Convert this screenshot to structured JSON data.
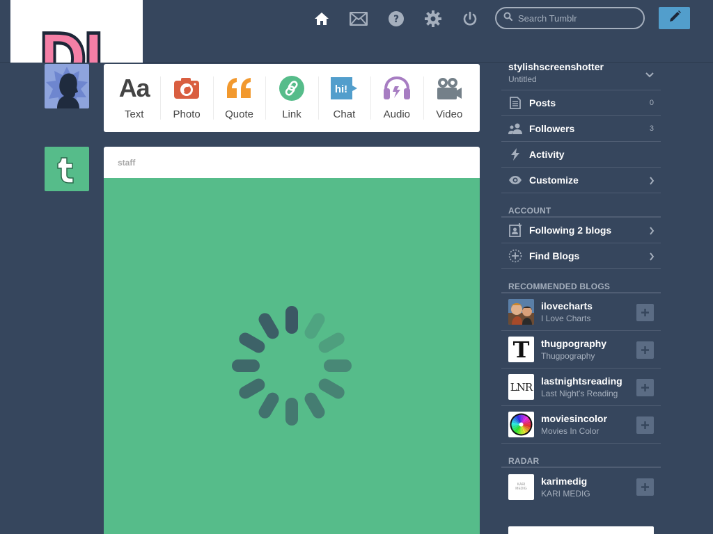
{
  "header": {
    "logo_text": "DL",
    "search": {
      "placeholder": "Search Tumblr",
      "value": ""
    },
    "nav_icons": [
      "home-icon",
      "mail-icon",
      "help-icon",
      "settings-icon",
      "power-icon"
    ],
    "compose_icon": "pencil-icon"
  },
  "post_types": [
    {
      "label": "Text",
      "icon": "text-icon",
      "color": "#444444"
    },
    {
      "label": "Photo",
      "icon": "camera-icon",
      "color": "#d95e40"
    },
    {
      "label": "Quote",
      "icon": "quote-icon",
      "color": "#f2992e"
    },
    {
      "label": "Link",
      "icon": "link-icon",
      "color": "#56bc8a"
    },
    {
      "label": "Chat",
      "icon": "chat-icon",
      "color": "#529ecc",
      "icon_text": "hi!"
    },
    {
      "label": "Audio",
      "icon": "headphones-icon",
      "color": "#a77dc2"
    },
    {
      "label": "Video",
      "icon": "video-camera-icon",
      "color": "#748089"
    }
  ],
  "staff_post": {
    "author": "staff",
    "state": "loading"
  },
  "sidebar": {
    "blog": {
      "name": "stylishscreenshotter",
      "title": "Untitled"
    },
    "items": [
      {
        "label": "Posts",
        "count": "0",
        "icon": "posts-icon"
      },
      {
        "label": "Followers",
        "count": "3",
        "icon": "followers-icon"
      },
      {
        "label": "Activity",
        "icon": "lightning-icon"
      },
      {
        "label": "Customize",
        "icon": "eye-icon"
      }
    ],
    "account_heading": "ACCOUNT",
    "account_items": [
      {
        "label": "Following 2 blogs",
        "icon": "following-icon"
      },
      {
        "label": "Find Blogs",
        "icon": "find-blogs-icon"
      }
    ],
    "recommended_heading": "RECOMMENDED BLOGS",
    "recommended": [
      {
        "name": "ilovecharts",
        "title": "I Love Charts"
      },
      {
        "name": "thugpography",
        "title": "Thugpography",
        "avatar_text": "T"
      },
      {
        "name": "lastnightsreading",
        "title": "Last Night's Reading",
        "avatar_text": "LNR"
      },
      {
        "name": "moviesincolor",
        "title": "Movies In Color"
      }
    ],
    "radar_heading": "RADAR",
    "radar": {
      "name": "karimedig",
      "title": "KARI MEDIG",
      "avatar_text": "KARI MEDIG"
    }
  },
  "colors": {
    "background": "#36465d",
    "accent_blue": "#529ecc",
    "staff_green": "#56bc8a",
    "muted_text": "#a5afbd"
  }
}
